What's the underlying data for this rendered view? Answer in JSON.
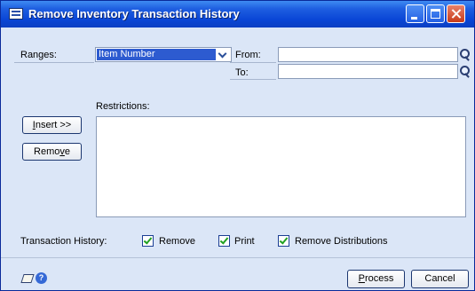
{
  "window": {
    "title": "Remove Inventory Transaction History",
    "icon": "window-doc-icon",
    "controls": [
      "minimize-icon",
      "maximize-icon",
      "close-icon"
    ]
  },
  "ranges": {
    "label": "Ranges:",
    "selected": "Item Number",
    "from_label": "From:",
    "to_label": "To:",
    "from_value": "",
    "to_value": ""
  },
  "restrictions": {
    "label": "Restrictions:",
    "insert_prefix": "I",
    "insert_rest": "nsert >>",
    "remove_prefix": "Remo",
    "remove_accel": "v",
    "remove_rest": "e",
    "items": []
  },
  "transaction_history": {
    "label": "Transaction History:",
    "options": [
      {
        "label": "Remove",
        "checked": true
      },
      {
        "label": "Print",
        "checked": true
      },
      {
        "label": "Remove Distributions",
        "checked": true
      }
    ]
  },
  "footer": {
    "process_accel": "P",
    "process_rest": "rocess",
    "cancel_label": "Cancel",
    "icons": [
      "note-icon",
      "help-icon"
    ]
  }
}
